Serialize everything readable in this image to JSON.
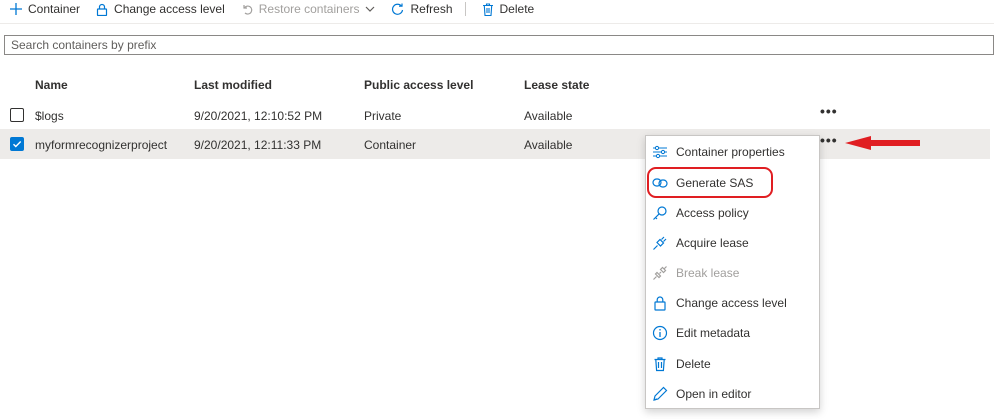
{
  "toolbar": {
    "items": [
      {
        "label": "Container",
        "icon": "plus-icon",
        "enabled": true
      },
      {
        "label": "Change access level",
        "icon": "lock-icon",
        "enabled": true
      },
      {
        "label": "Restore containers",
        "icon": "undo-icon",
        "enabled": false
      },
      {
        "label": "Refresh",
        "icon": "refresh-icon",
        "enabled": true
      },
      {
        "label": "Delete",
        "icon": "trash-icon",
        "enabled": true
      }
    ]
  },
  "search": {
    "placeholder": "Search containers by prefix",
    "value": ""
  },
  "table": {
    "columns": [
      "Name",
      "Last modified",
      "Public access level",
      "Lease state"
    ],
    "rows": [
      {
        "name": "$logs",
        "modified": "9/20/2021, 12:10:52 PM",
        "access": "Private",
        "lease": "Available",
        "selected": false
      },
      {
        "name": "myformrecognizerproject",
        "modified": "9/20/2021, 12:11:33 PM",
        "access": "Container",
        "lease": "Available",
        "selected": true
      }
    ],
    "more_glyph": "•••"
  },
  "context_menu": {
    "items": [
      {
        "label": "Container properties",
        "icon": "sliders-icon",
        "enabled": true
      },
      {
        "label": "Generate SAS",
        "icon": "link-icon",
        "enabled": true,
        "highlighted": true
      },
      {
        "label": "Access policy",
        "icon": "key-icon",
        "enabled": true
      },
      {
        "label": "Acquire lease",
        "icon": "plug-icon",
        "enabled": true
      },
      {
        "label": "Break lease",
        "icon": "unplug-icon",
        "enabled": false
      },
      {
        "label": "Change access level",
        "icon": "lock-icon",
        "enabled": true
      },
      {
        "label": "Edit metadata",
        "icon": "info-icon",
        "enabled": true
      },
      {
        "label": "Delete",
        "icon": "trash-icon",
        "enabled": true
      },
      {
        "label": "Open in editor",
        "icon": "pencil-icon",
        "enabled": true
      }
    ]
  },
  "colors": {
    "accent": "#0078d4",
    "annotation": "#e01e22",
    "selected_row": "#edebe9"
  }
}
